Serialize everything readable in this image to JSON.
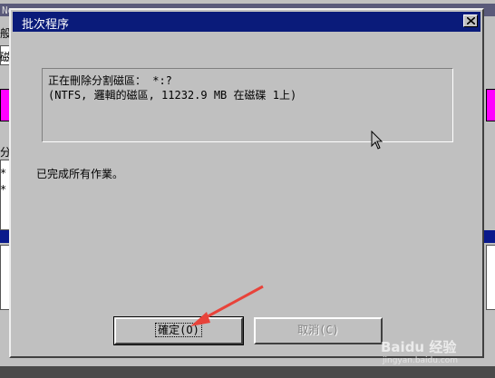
{
  "background_window": {
    "title_fragment": "Ne",
    "left_texts": [
      "般",
      "磁",
      "分",
      "*:",
      "*:"
    ]
  },
  "dialog": {
    "title": "批次程序",
    "message_line1": "正在刪除分割磁區： *:?",
    "message_line2": "(NTFS, 邏輯的磁區, 11232.9 MB 在磁碟 1上)",
    "status": "已完成所有作業。",
    "ok_label": "確定(O)",
    "cancel_label": "取消(C)"
  },
  "watermark": {
    "brand": "Baidu 经验",
    "url": "jingyan.baidu.com"
  },
  "colors": {
    "titlebar": "#0a1b7a",
    "dialog_bg": "#c0c0c0",
    "arrow": "#e8433a"
  }
}
